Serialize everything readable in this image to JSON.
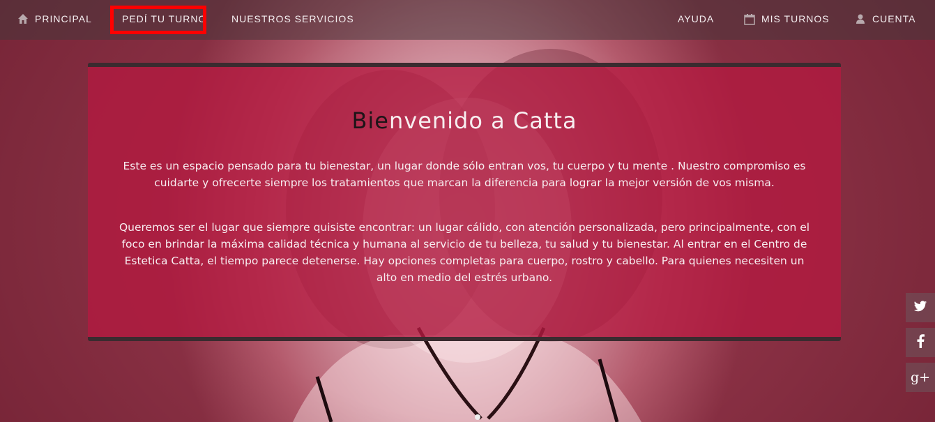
{
  "nav": {
    "left": [
      {
        "label": "PRINCIPAL",
        "icon": "home-icon"
      },
      {
        "label": "PEDÍ TU TURNO"
      },
      {
        "label": "NUESTROS SERVICIOS"
      }
    ],
    "right": [
      {
        "label": "AYUDA"
      },
      {
        "label": "MIS TURNOS",
        "icon": "calendar-icon"
      },
      {
        "label": "CUENTA",
        "icon": "user-icon"
      }
    ],
    "highlighted_item": "PEDÍ TU TURNO",
    "highlight_color": "#ff0000"
  },
  "welcome": {
    "title_dark": "Bie",
    "title_light": "nvenido a Catta",
    "paragraph1": "Este es un espacio pensado para tu bienestar, un lugar donde sólo entran vos, tu cuerpo y tu mente . Nuestro compromiso es cuidarte y ofrecerte siempre los tratamientos que marcan la diferencia para lograr la mejor versión de vos misma.",
    "paragraph2": "Queremos ser el lugar que siempre quisiste encontrar: un lugar cálido, con atención personalizada, pero principalmente, con el foco en brindar la máxima calidad técnica y humana al servicio de tu belleza, tu salud y tu bienestar. Al entrar en el Centro de Estetica Catta, el tiempo parece detenerse. Hay opciones completas para cuerpo, rostro y cabello. Para quienes necesiten un alto en medio del estrés urbano."
  },
  "social": {
    "twitter_icon": "twitter-icon",
    "facebook_icon": "facebook-icon",
    "gplus_icon": "google-plus-icon",
    "gplus_glyph": "g+"
  },
  "colors": {
    "panel": "#b41a40",
    "navbar": "#46373a"
  }
}
